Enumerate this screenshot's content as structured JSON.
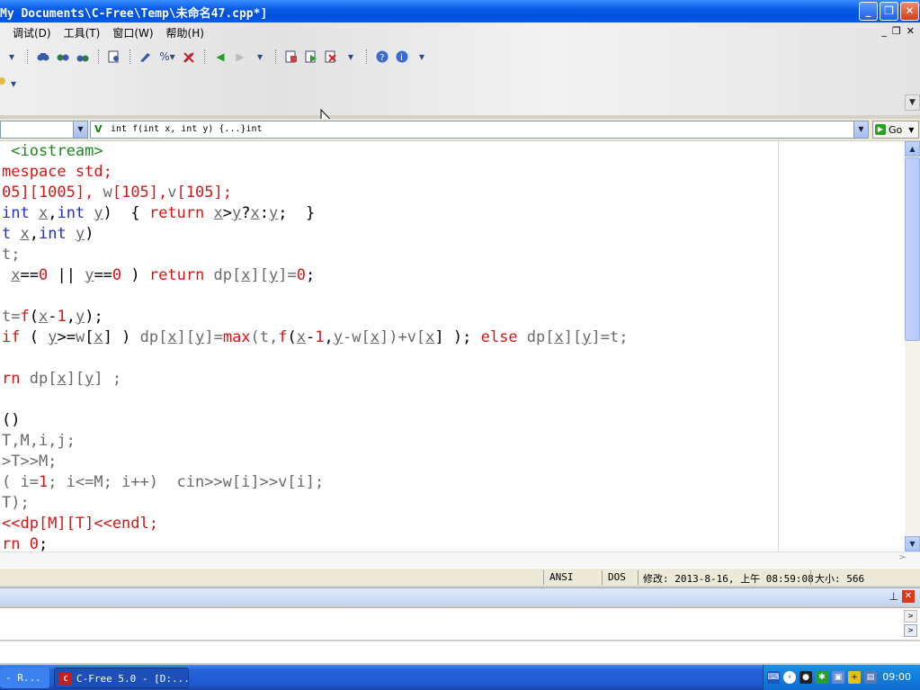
{
  "window": {
    "title": "My Documents\\C-Free\\Temp\\未命名47.cpp*]",
    "minimize": "_",
    "maximize": "❐",
    "close": "✕"
  },
  "menu": {
    "items": [
      "调试(D)",
      "工具(T)",
      "窗口(W)",
      "帮助(H)"
    ],
    "mdi_controls": [
      "_",
      "❐",
      "✕"
    ]
  },
  "navigation": {
    "function_combo_value": "int f(int x, int y) {...}int",
    "go_label": "Go"
  },
  "code_lines": [
    [
      {
        "t": " <iostream>",
        "c": "grn"
      }
    ],
    [
      {
        "t": "mespace std;",
        "c": "r"
      }
    ],
    [
      {
        "t": "05][1005], ",
        "c": "r"
      },
      {
        "t": "w",
        "c": "g"
      },
      {
        "t": "[105],",
        "c": "r"
      },
      {
        "t": "v",
        "c": "g"
      },
      {
        "t": "[105];",
        "c": "r"
      }
    ],
    [
      {
        "t": "int ",
        "c": "b"
      },
      {
        "t": "x",
        "c": "u"
      },
      {
        "t": ",",
        "c": "k"
      },
      {
        "t": "int ",
        "c": "b"
      },
      {
        "t": "y",
        "c": "u"
      },
      {
        "t": ")  { ",
        "c": "k"
      },
      {
        "t": "return ",
        "c": "r"
      },
      {
        "t": "x",
        "c": "u"
      },
      {
        "t": ">",
        "c": "k"
      },
      {
        "t": "y",
        "c": "u"
      },
      {
        "t": "?",
        "c": "k"
      },
      {
        "t": "x",
        "c": "u"
      },
      {
        "t": ":",
        "c": "k"
      },
      {
        "t": "y",
        "c": "u"
      },
      {
        "t": ";  }",
        "c": "k"
      }
    ],
    [
      {
        "t": "t ",
        "c": "b"
      },
      {
        "t": "x",
        "c": "u"
      },
      {
        "t": ",",
        "c": "k"
      },
      {
        "t": "int ",
        "c": "b"
      },
      {
        "t": "y",
        "c": "u"
      },
      {
        "t": ")",
        "c": "k"
      }
    ],
    [
      {
        "t": "t;",
        "c": "g"
      }
    ],
    [
      {
        "t": " ",
        "c": "k"
      },
      {
        "t": "x",
        "c": "u"
      },
      {
        "t": "==",
        "c": "k"
      },
      {
        "t": "0",
        "c": "r"
      },
      {
        "t": " || ",
        "c": "k"
      },
      {
        "t": "y",
        "c": "u"
      },
      {
        "t": "==",
        "c": "k"
      },
      {
        "t": "0",
        "c": "r"
      },
      {
        "t": " ) ",
        "c": "k"
      },
      {
        "t": "return ",
        "c": "r"
      },
      {
        "t": "dp[",
        "c": "g"
      },
      {
        "t": "x",
        "c": "u"
      },
      {
        "t": "][",
        "c": "g"
      },
      {
        "t": "y",
        "c": "u"
      },
      {
        "t": "]=",
        "c": "g"
      },
      {
        "t": "0",
        "c": "r"
      },
      {
        "t": ";",
        "c": "k"
      }
    ],
    [
      {
        "t": "",
        "c": "k"
      }
    ],
    [
      {
        "t": "t=",
        "c": "g"
      },
      {
        "t": "f",
        "c": "r"
      },
      {
        "t": "(",
        "c": "k"
      },
      {
        "t": "x",
        "c": "u"
      },
      {
        "t": "-",
        "c": "k"
      },
      {
        "t": "1",
        "c": "r"
      },
      {
        "t": ",",
        "c": "k"
      },
      {
        "t": "y",
        "c": "u"
      },
      {
        "t": ");",
        "c": "k"
      }
    ],
    [
      {
        "t": "if ",
        "c": "r"
      },
      {
        "t": "( ",
        "c": "k"
      },
      {
        "t": "y",
        "c": "u"
      },
      {
        "t": ">=",
        "c": "k"
      },
      {
        "t": "w",
        "c": "g"
      },
      {
        "t": "[",
        "c": "k"
      },
      {
        "t": "x",
        "c": "u"
      },
      {
        "t": "] ) ",
        "c": "k"
      },
      {
        "t": "dp[",
        "c": "g"
      },
      {
        "t": "x",
        "c": "u"
      },
      {
        "t": "][",
        "c": "g"
      },
      {
        "t": "y",
        "c": "u"
      },
      {
        "t": "]=",
        "c": "g"
      },
      {
        "t": "max",
        "c": "r"
      },
      {
        "t": "(t,",
        "c": "g"
      },
      {
        "t": "f",
        "c": "r"
      },
      {
        "t": "(",
        "c": "k"
      },
      {
        "t": "x",
        "c": "u"
      },
      {
        "t": "-",
        "c": "k"
      },
      {
        "t": "1",
        "c": "r"
      },
      {
        "t": ",",
        "c": "k"
      },
      {
        "t": "y",
        "c": "u"
      },
      {
        "t": "-w[",
        "c": "g"
      },
      {
        "t": "x",
        "c": "u"
      },
      {
        "t": "])+v[",
        "c": "g"
      },
      {
        "t": "x",
        "c": "u"
      },
      {
        "t": "] ); ",
        "c": "k"
      },
      {
        "t": "else ",
        "c": "r"
      },
      {
        "t": "dp[",
        "c": "g"
      },
      {
        "t": "x",
        "c": "u"
      },
      {
        "t": "][",
        "c": "g"
      },
      {
        "t": "y",
        "c": "u"
      },
      {
        "t": "]=t;",
        "c": "g"
      }
    ],
    [
      {
        "t": "",
        "c": "k"
      }
    ],
    [
      {
        "t": "rn ",
        "c": "r"
      },
      {
        "t": "dp[",
        "c": "g"
      },
      {
        "t": "x",
        "c": "u"
      },
      {
        "t": "][",
        "c": "g"
      },
      {
        "t": "y",
        "c": "u"
      },
      {
        "t": "] ;",
        "c": "g"
      }
    ],
    [
      {
        "t": "",
        "c": "k"
      }
    ],
    [
      {
        "t": "()",
        "c": "k"
      }
    ],
    [
      {
        "t": "T,M,i,j;",
        "c": "g"
      }
    ],
    [
      {
        "t": ">T>>M;",
        "c": "g"
      }
    ],
    [
      {
        "t": "( i=",
        "c": "g"
      },
      {
        "t": "1",
        "c": "r"
      },
      {
        "t": "; i<=M; i++)  cin>>w[i]>>v[i];",
        "c": "g"
      }
    ],
    [
      {
        "t": "T);",
        "c": "g"
      }
    ],
    [
      {
        "t": "<<dp[M][T]<<endl;",
        "c": "r"
      }
    ],
    [
      {
        "t": "rn ",
        "c": "r"
      },
      {
        "t": "0",
        "c": "r"
      },
      {
        "t": ";",
        "c": "k"
      }
    ]
  ],
  "status": {
    "encoding": "ANSI",
    "line_ending": "DOS",
    "modified": "修改: 2013-8-16, 上午 08:59:08",
    "size": "大小: 566"
  },
  "taskbar": {
    "task1": "- R...",
    "task2": "C-Free 5.0 - [D:...",
    "clock": "09:00"
  }
}
